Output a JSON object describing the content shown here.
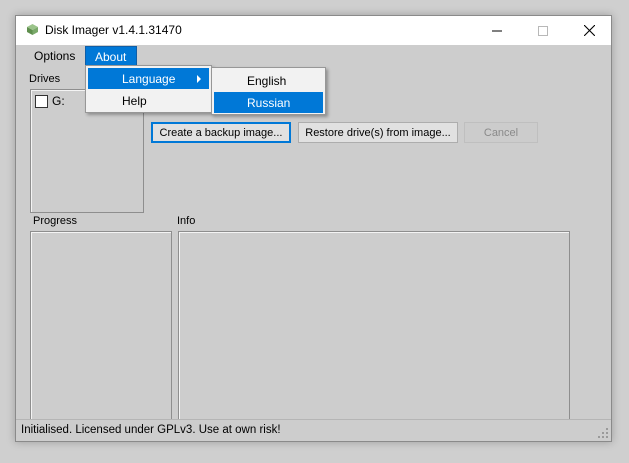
{
  "window": {
    "title": "Disk Imager v1.4.1.31470"
  },
  "menubar": {
    "options": "Options",
    "about": "About"
  },
  "about_menu": {
    "items": [
      {
        "label": "Language",
        "has_submenu": true
      },
      {
        "label": "Help",
        "has_submenu": false
      }
    ]
  },
  "language_menu": {
    "items": [
      {
        "label": "English"
      },
      {
        "label": "Russian"
      }
    ]
  },
  "drives": {
    "label": "Drives",
    "items": [
      {
        "label": "G:",
        "checked": false
      }
    ]
  },
  "buttons": {
    "backup": "Create a backup image...",
    "restore": "Restore drive(s) from image...",
    "cancel": "Cancel"
  },
  "progress": {
    "label": "Progress"
  },
  "info": {
    "label": "Info"
  },
  "status": {
    "text": "Initialised. Licensed under GPLv3. Use at own risk!"
  },
  "colors": {
    "accent": "#0078d7",
    "window_bg": "#cdcdcd"
  }
}
